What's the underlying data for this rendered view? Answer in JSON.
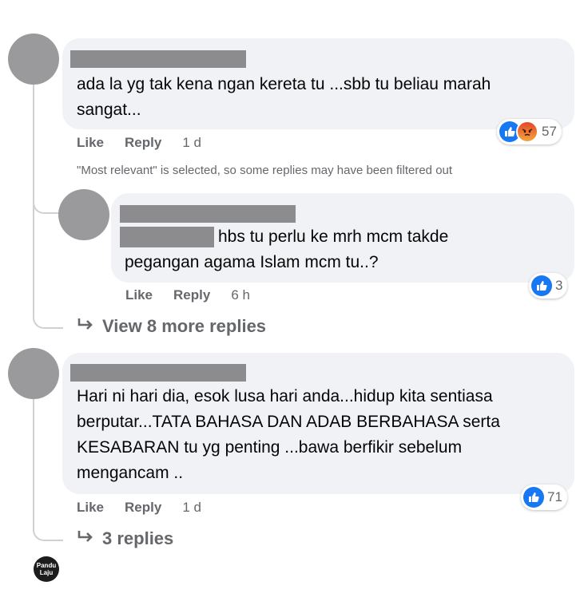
{
  "comments": [
    {
      "text_lines": [
        "ada la yg tak kena ngan kereta tu ...sbb tu beliau marah",
        "sangat..."
      ],
      "actions": {
        "like": "Like",
        "reply": "Reply",
        "time": "1 d"
      },
      "reaction_count": "57",
      "reaction_icons": [
        "like-icon",
        "angry-icon"
      ]
    },
    {
      "text_lines": [
        "hbs tu perlu ke mrh mcm takde",
        "pegangan agama Islam mcm tu..?"
      ],
      "actions": {
        "like": "Like",
        "reply": "Reply",
        "time": "6 h"
      },
      "reaction_count": "3",
      "reaction_icons": [
        "like-icon"
      ]
    },
    {
      "text_lines": [
        "Hari ni hari dia, esok lusa hari anda...hidup kita sentiasa",
        "berputar...TATA BAHASA DAN ADAB BERBAHASA serta",
        "KESABARAN tu yg penting ...bawa berfikir sebelum",
        "mengancam .."
      ],
      "actions": {
        "like": "Like",
        "reply": "Reply",
        "time": "1 d"
      },
      "reaction_count": "71",
      "reaction_icons": [
        "like-icon"
      ]
    }
  ],
  "filter_notice": "\"Most relevant\" is selected, so some replies may have been filtered out",
  "view_more_replies": "View 8 more replies",
  "replies_link": "3 replies",
  "watermark": {
    "line1": "Pandu",
    "line2": "Laju"
  },
  "colors": {
    "like_blue": "#1877f2",
    "bubble_bg": "#f0f2f5",
    "muted": "#65676b",
    "redaction": "#8c8c8f"
  }
}
